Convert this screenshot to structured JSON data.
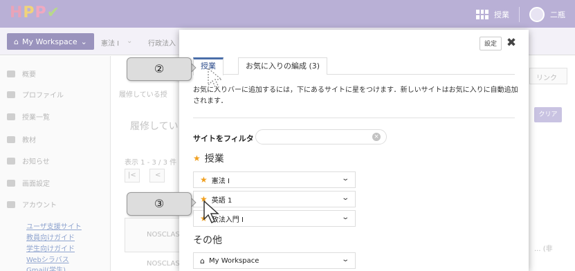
{
  "topbar": {
    "logo_letters": [
      "H",
      "P",
      "P"
    ],
    "lessons_label": "授業",
    "user_name": "二瓶"
  },
  "subbar": {
    "workspace_label": "My Workspace",
    "tab1": "憲法 I",
    "tab2": "行政法入"
  },
  "sidebar": {
    "items": [
      {
        "label": "概要",
        "icon": "list-icon"
      },
      {
        "label": "プロファイル",
        "icon": "user-icon"
      },
      {
        "label": "授業一覧",
        "icon": "group-icon"
      },
      {
        "label": "教材",
        "icon": "folder-icon"
      },
      {
        "label": "お知らせ",
        "icon": "megaphone-icon"
      },
      {
        "label": "画面設定",
        "icon": "gear-icon"
      },
      {
        "label": "アカウント",
        "icon": "user-icon"
      }
    ],
    "links": [
      "ユーザ支援サイト",
      "教員向けガイド",
      "学生向けガイド",
      "Webシラバス",
      "Gmail(学生)"
    ]
  },
  "background": {
    "breadcrumb": "履修している授",
    "heading": "履修してい",
    "count_text": "表示 1 - 3 / 3 件",
    "link_button": "リンク",
    "clear_button": "クリア",
    "row1": "NOSCLAS",
    "row2": "NOSCLAS",
    "row_suffix": "... (非",
    "pager_first": "|<",
    "pager_prev": "<"
  },
  "modal": {
    "settings_button": "設定",
    "close_glyph": "✖",
    "tab_active": "授業",
    "tab_favorites": "お気に入りの編成 (3)",
    "description": "お気に入りバーに追加するには，下にあるサイトに星をつけます．新しいサイトはお気に入りに自動追加されます．",
    "filter_label": "サイトをフィルタ",
    "filter_value": "",
    "clear_glyph": "×",
    "section_lessons": "授業",
    "sites": [
      "憲法 I",
      "英語 1",
      "政法入門 I"
    ],
    "section_other": "その他",
    "other_sites": [
      "My Workspace"
    ]
  },
  "callouts": {
    "step2": "②",
    "step3": "③"
  },
  "colors": {
    "topbar": "#b9b0d6",
    "accent": "#4a6ea9",
    "star": "#f0a020"
  }
}
